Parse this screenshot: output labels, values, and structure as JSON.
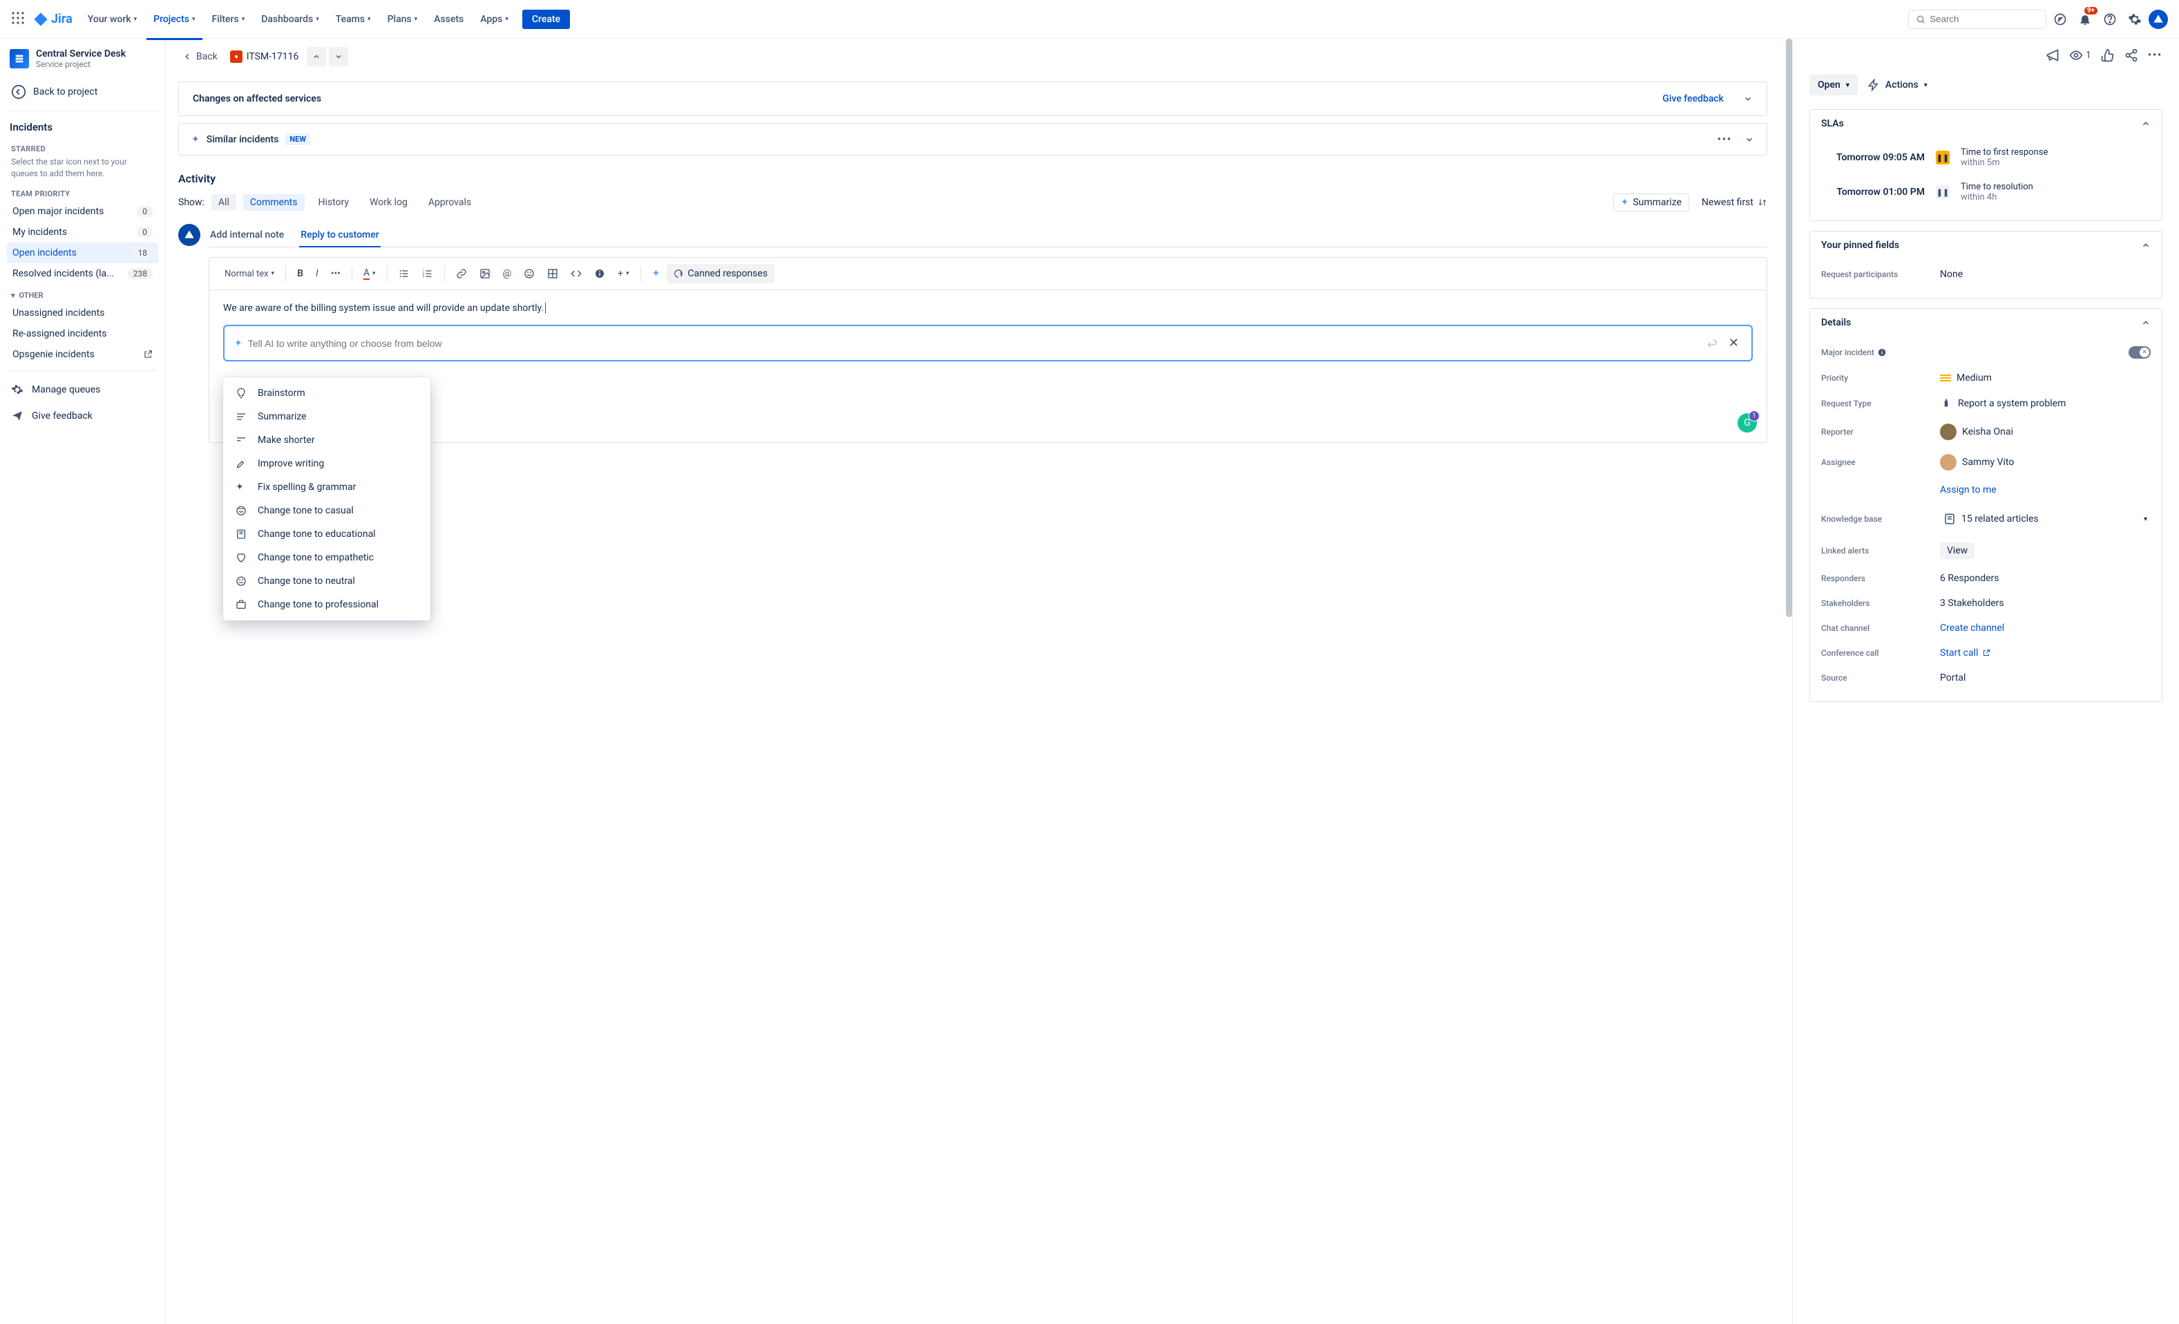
{
  "topnav": {
    "links": [
      "Your work",
      "Projects",
      "Filters",
      "Dashboards",
      "Teams",
      "Plans",
      "Assets",
      "Apps"
    ],
    "active_index": 1,
    "create": "Create",
    "search_placeholder": "Search",
    "notif_count": "9+"
  },
  "sidebar": {
    "project_name": "Central Service Desk",
    "project_type": "Service project",
    "back_link": "Back to project",
    "section_head": "Incidents",
    "starred_label": "STARRED",
    "starred_hint": "Select the star icon next to your queues to add them here.",
    "team_priority_label": "TEAM PRIORITY",
    "queues": [
      {
        "label": "Open major incidents",
        "count": "0",
        "active": false
      },
      {
        "label": "My incidents",
        "count": "0",
        "active": false
      },
      {
        "label": "Open incidents",
        "count": "18",
        "active": true
      },
      {
        "label": "Resolved incidents (la...",
        "count": "238",
        "active": false
      }
    ],
    "other_label": "OTHER",
    "other": [
      "Unassigned incidents",
      "Re-assigned incidents",
      "Opsgenie incidents"
    ],
    "tools": [
      "Manage queues",
      "Give feedback"
    ]
  },
  "crumb": {
    "back": "Back",
    "key": "ITSM-17116"
  },
  "panels": {
    "changes_title": "Changes on affected services",
    "feedback": "Give feedback",
    "similar_title": "Similar incidents",
    "new_badge": "NEW"
  },
  "activity": {
    "title": "Activity",
    "show_label": "Show:",
    "tabs": [
      "All",
      "Comments",
      "History",
      "Work log",
      "Approvals"
    ],
    "active_tab_index": 1,
    "summarize": "Summarize",
    "sort": "Newest first"
  },
  "compose": {
    "tabs": [
      "Add internal note",
      "Reply to customer"
    ],
    "active_tab_index": 1,
    "text_style": "Normal tex",
    "canned": "Canned responses",
    "typed_text": "We are aware of the billing system issue and will provide an update shortly.",
    "ai_placeholder": "Tell AI to write anything or choose from below",
    "ai_menu": [
      "Brainstorm",
      "Summarize",
      "Make shorter",
      "Improve writing",
      "Fix spelling & grammar",
      "Change tone to casual",
      "Change tone to educational",
      "Change tone to empathetic",
      "Change tone to neutral",
      "Change tone to professional"
    ]
  },
  "right": {
    "watch_count": "1",
    "status": "Open",
    "actions": "Actions",
    "slas_title": "SLAs",
    "slas": [
      {
        "time": "Tomorrow 09:05 AM",
        "paused": "y",
        "title": "Time to first response",
        "sub": "within 5m"
      },
      {
        "time": "Tomorrow 01:00 PM",
        "paused": "g",
        "title": "Time to resolution",
        "sub": "within 4h"
      }
    ],
    "pinned_title": "Your pinned fields",
    "pinned_label": "Request participants",
    "pinned_value": "None",
    "details_title": "Details",
    "fields": {
      "major_incident_label": "Major incident",
      "priority_label": "Priority",
      "priority_value": "Medium",
      "request_type_label": "Request Type",
      "request_type_value": "Report a system problem",
      "reporter_label": "Reporter",
      "reporter_value": "Keisha Onai",
      "assignee_label": "Assignee",
      "assignee_value": "Sammy Vito",
      "assign_to_me": "Assign to me",
      "kb_label": "Knowledge base",
      "kb_value": "15 related articles",
      "alerts_label": "Linked alerts",
      "alerts_value": "View",
      "responders_label": "Responders",
      "responders_value": "6 Responders",
      "stakeholders_label": "Stakeholders",
      "stakeholders_value": "3 Stakeholders",
      "chat_label": "Chat channel",
      "chat_value": "Create channel",
      "conf_label": "Conference call",
      "conf_value": "Start call",
      "source_label": "Source",
      "source_value": "Portal"
    }
  }
}
